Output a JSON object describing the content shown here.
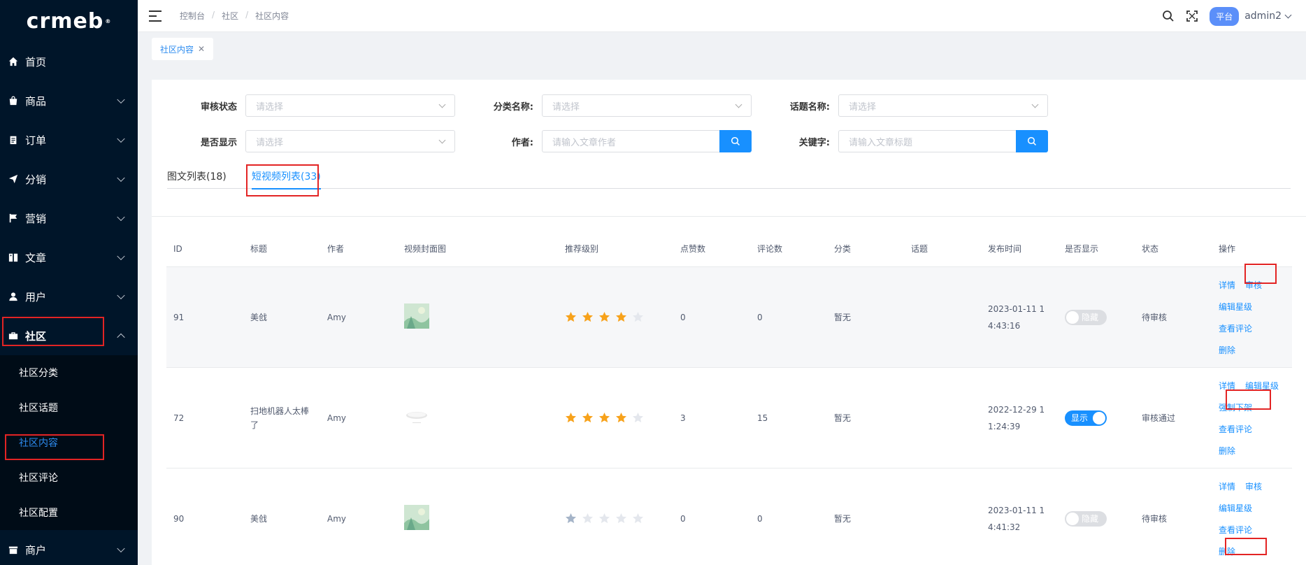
{
  "sidebar": {
    "logo": "crmeb",
    "items": [
      {
        "label": "首页"
      },
      {
        "label": "商品"
      },
      {
        "label": "订单"
      },
      {
        "label": "分销"
      },
      {
        "label": "营销"
      },
      {
        "label": "文章"
      },
      {
        "label": "用户"
      },
      {
        "label": "社区"
      },
      {
        "label": "商户"
      }
    ],
    "submenu": [
      {
        "label": "社区分类"
      },
      {
        "label": "社区话题"
      },
      {
        "label": "社区内容"
      },
      {
        "label": "社区评论"
      },
      {
        "label": "社区配置"
      }
    ]
  },
  "header": {
    "breadcrumb": [
      "控制台",
      "社区",
      "社区内容"
    ],
    "platform_badge": "平台",
    "admin": "admin2"
  },
  "tagsbar": {
    "tag": "社区内容"
  },
  "filters": {
    "audit_status": {
      "label": "审核状态",
      "placeholder": "请选择"
    },
    "category": {
      "label": "分类名称:",
      "placeholder": "请选择"
    },
    "topic": {
      "label": "话题名称:",
      "placeholder": "请选择"
    },
    "is_show": {
      "label": "是否显示",
      "placeholder": "请选择"
    },
    "author": {
      "label": "作者:",
      "placeholder": "请输入文章作者"
    },
    "keyword": {
      "label": "关键字:",
      "placeholder": "请输入文章标题"
    }
  },
  "tabs": [
    {
      "label": "图文列表(18)"
    },
    {
      "label": "短视频列表(33)"
    }
  ],
  "table": {
    "headers": [
      "ID",
      "标题",
      "作者",
      "视频封面图",
      "推荐级别",
      "点赞数",
      "评论数",
      "分类",
      "话题",
      "发布时间",
      "是否显示",
      "状态",
      "操作"
    ],
    "rows": [
      {
        "id": "91",
        "title": "美戗",
        "author": "Amy",
        "stars": 4,
        "likes": "0",
        "comments": "0",
        "category": "暂无",
        "topic": "",
        "time": "2023-01-11 14:43:16",
        "show": "隐藏",
        "status": "待审核"
      },
      {
        "id": "72",
        "title": "扫地机器人太棒了",
        "author": "Amy",
        "stars": 4,
        "likes": "3",
        "comments": "15",
        "category": "暂无",
        "topic": "",
        "time": "2022-12-29 11:24:39",
        "show": "显示",
        "status": "审核通过"
      },
      {
        "id": "90",
        "title": "美戗",
        "author": "Amy",
        "stars": 1,
        "likes": "0",
        "comments": "0",
        "category": "暂无",
        "topic": "",
        "time": "2023-01-11 14:41:32",
        "show": "隐藏",
        "status": "待审核"
      }
    ],
    "ops": {
      "detail": "详情",
      "audit": "审核",
      "edit_stars": "编辑星级",
      "view_comments": "查看评论",
      "delete": "删除",
      "force_off": "强制下架"
    }
  },
  "colors": {
    "sidebar_bg": "#001529",
    "primary": "#1890ff",
    "star_on": "#f7a21b",
    "star_off": "#e4e7ed",
    "highlight_box": "#e32424"
  }
}
